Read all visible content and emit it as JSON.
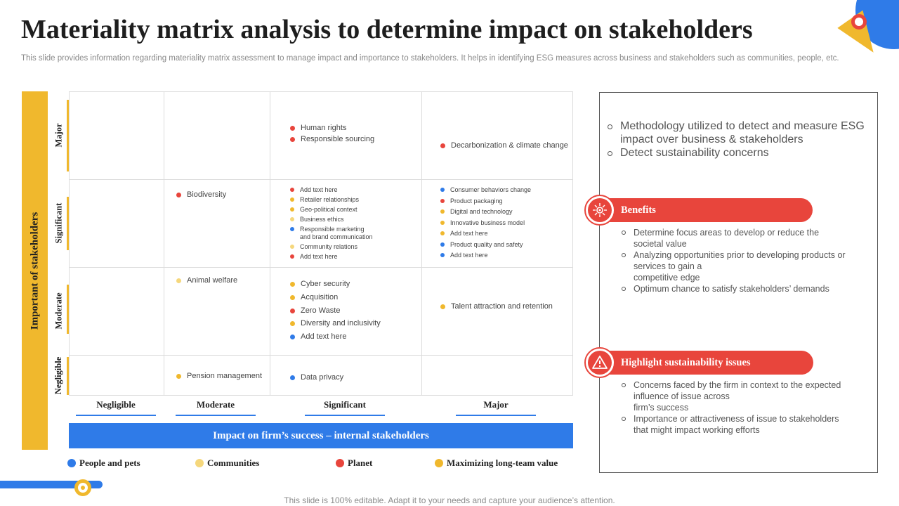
{
  "header": {
    "title": "Materiality matrix analysis to determine impact on stakeholders",
    "subtitle": "This slide provides information regarding materiality matrix assessment to manage impact and importance to stakeholders. It helps in identifying ESG measures across business and stakeholders such as communities, people, etc."
  },
  "colors": {
    "people": "#2f7be8",
    "communities": "#f5d77c",
    "planet": "#e8453c",
    "value": "#f0b82d",
    "accent_red": "#e8453c",
    "accent_yellow": "#f0b82d",
    "accent_blue": "#2f7be8"
  },
  "matrix": {
    "y_axis_title": "Important of stakeholders",
    "x_axis_title": "Impact on firm’s success – internal stakeholders",
    "rows": [
      "Major",
      "Significant",
      "Moderate",
      "Negligible"
    ],
    "columns": [
      "Negligible",
      "Moderate",
      "Significant",
      "Major"
    ],
    "cells": {
      "major_significant": [
        {
          "text": "Human rights",
          "category": "planet"
        },
        {
          "text": "Responsible sourcing",
          "category": "planet"
        }
      ],
      "major_major": [
        {
          "text": "Decarbonization & climate change",
          "category": "planet"
        }
      ],
      "significant_moderate": [
        {
          "text": "Biodiversity",
          "category": "planet"
        }
      ],
      "significant_significant": [
        {
          "text": "Add text here",
          "category": "planet"
        },
        {
          "text": "Retailer relationships",
          "category": "value"
        },
        {
          "text": "Geo-political context",
          "category": "value"
        },
        {
          "text": "Business ethics",
          "category": "communities"
        },
        {
          "text": "Responsible marketing\nand brand communication",
          "category": "people"
        },
        {
          "text": "Community relations",
          "category": "communities"
        },
        {
          "text": "Add text here",
          "category": "planet"
        }
      ],
      "significant_major": [
        {
          "text": "Consumer behaviors change",
          "category": "people"
        },
        {
          "text": "Product packaging",
          "category": "planet"
        },
        {
          "text": "Digital and technology",
          "category": "value"
        },
        {
          "text": "Innovative business model",
          "category": "value"
        },
        {
          "text": "Add text here",
          "category": "value"
        },
        {
          "text": "Product quality and safety",
          "category": "people"
        },
        {
          "text": "Add text here",
          "category": "people"
        }
      ],
      "moderate_moderate": [
        {
          "text": "Animal welfare",
          "category": "communities"
        }
      ],
      "moderate_significant": [
        {
          "text": "Cyber security",
          "category": "value"
        },
        {
          "text": "Acquisition",
          "category": "value"
        },
        {
          "text": "Zero Waste",
          "category": "planet"
        },
        {
          "text": "Diversity and inclusivity",
          "category": "value"
        },
        {
          "text": "Add text here",
          "category": "people"
        }
      ],
      "moderate_major": [
        {
          "text": "Talent attraction and retention",
          "category": "value"
        }
      ],
      "negligible_moderate": [
        {
          "text": "Pension management",
          "category": "value"
        }
      ],
      "negligible_significant": [
        {
          "text": "Data privacy",
          "category": "people"
        }
      ]
    }
  },
  "legend": [
    {
      "label": "People and pets",
      "category": "people"
    },
    {
      "label": "Communities",
      "category": "communities"
    },
    {
      "label": "Planet",
      "category": "planet"
    },
    {
      "label": "Maximizing long-team value",
      "category": "value"
    }
  ],
  "panel": {
    "intro": [
      "Methodology utilized to detect and measure ESG impact over business & stakeholders",
      "Detect sustainability concerns"
    ],
    "benefits": {
      "heading": "Benefits",
      "icon": "gear-network-icon",
      "items": [
        "Determine focus areas to develop  or reduce the\nsocietal value",
        "Analyzing opportunities prior to developing  products or\nservices to gain a\ncompetitive edge",
        "Optimum chance to satisfy stakeholders’ demands"
      ]
    },
    "issues": {
      "heading": "Highlight sustainability issues",
      "icon": "warning-gear-icon",
      "items": [
        "Concerns faced by the firm in context to the expected\ninfluence of issue across\nfirm’s success",
        "Importance  or attractiveness of issue to stakeholders\nthat might impact working efforts"
      ]
    }
  },
  "footer": "This slide is 100% editable. Adapt it to your needs and capture your audience’s attention."
}
